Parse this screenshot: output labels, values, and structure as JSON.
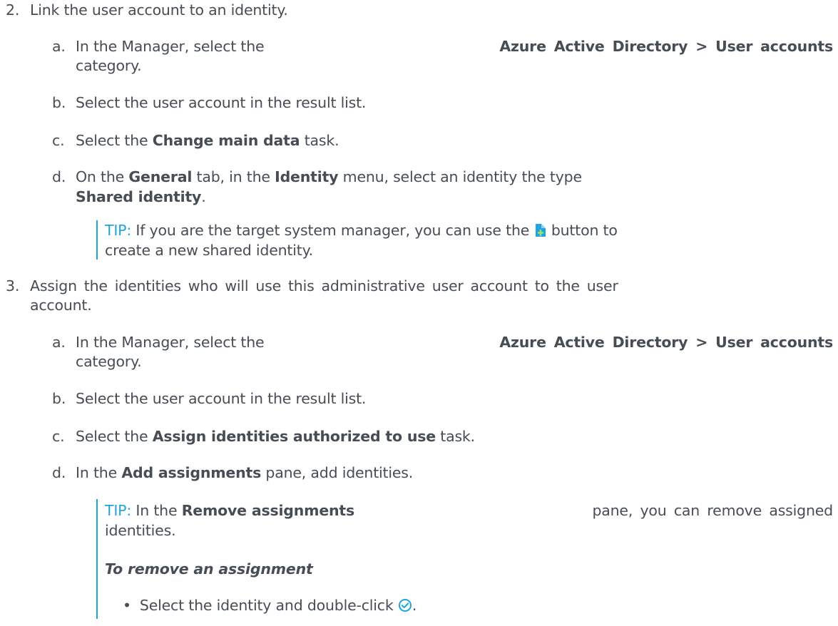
{
  "step2": {
    "number": "2.",
    "text": "Link the user account to an identity.",
    "substeps": [
      {
        "letter": "a.",
        "pre": "In the Manager, select the ",
        "bold": "Azure Active Directory > User accounts",
        "post_line2": "category."
      },
      {
        "letter": "b.",
        "text": "Select the user account in the result list."
      },
      {
        "letter": "c.",
        "pre": "Select the ",
        "bold": "Change main data",
        "post": " task."
      },
      {
        "letter": "d.",
        "pre": "On the ",
        "bold1": "General",
        "mid1": " tab, in the ",
        "bold2": "Identity",
        "mid2": " menu, select an identity the type",
        "bold3": "Shared identity",
        "post": "."
      }
    ],
    "tip": {
      "label": "TIP:",
      "pre": " If you are the target system manager, you can use the ",
      "icon": "add-new-icon",
      "post": " button to",
      "line2": "create a new shared identity."
    }
  },
  "step3": {
    "number": "3.",
    "text_line1": "Assign the identities who will use this administrative user account to the user",
    "text_line2": "account.",
    "substeps": [
      {
        "letter": "a.",
        "pre": "In the Manager, select the ",
        "bold": "Azure Active Directory > User accounts",
        "post_line2": "category."
      },
      {
        "letter": "b.",
        "text": "Select the user account in the result list."
      },
      {
        "letter": "c.",
        "pre": "Select the ",
        "bold": "Assign identities authorized to use",
        "post": " task."
      },
      {
        "letter": "d.",
        "pre": "In the ",
        "bold": "Add assignments",
        "post": " pane, add identities."
      }
    ],
    "tip": {
      "label": "TIP:",
      "pre": " In the ",
      "bold": "Remove assignments",
      "post": " pane, you can remove assigned",
      "line2": "identities.",
      "heading": "To remove an assignment",
      "bullet": "•",
      "bullet_text": "Select the identity and double-click ",
      "bullet_icon": "check-circle-icon",
      "bullet_end": "."
    }
  },
  "colors": {
    "text": "#474d55",
    "tip": "#1fa4dd"
  }
}
